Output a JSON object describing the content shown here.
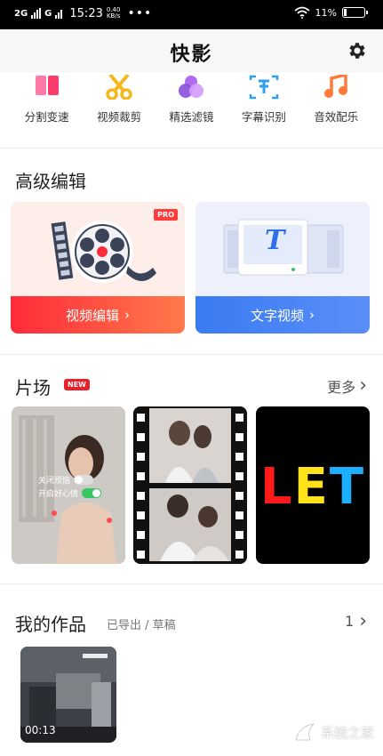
{
  "statusbar": {
    "network": "2G",
    "carrier_mark": "G",
    "time": "15:23",
    "speed_value": "0.40",
    "speed_unit": "KB/s",
    "more": "•••",
    "battery": "11%"
  },
  "header": {
    "title": "快影"
  },
  "tools": [
    {
      "label": "分割变速",
      "icon": "split-speed-icon"
    },
    {
      "label": "视频裁剪",
      "icon": "scissors-icon"
    },
    {
      "label": "精选滤镜",
      "icon": "filter-icon"
    },
    {
      "label": "字幕识别",
      "icon": "subtitle-icon"
    },
    {
      "label": "音效配乐",
      "icon": "music-icon"
    }
  ],
  "advanced": {
    "title": "高级编辑",
    "video_card": {
      "badge": "PRO",
      "label": "视频编辑"
    },
    "text_card": {
      "label": "文字视频",
      "art_letter": "T"
    }
  },
  "cinema": {
    "title": "片场",
    "badge": "NEW",
    "more_label": "更多",
    "thumb1": {
      "toggle_off_label": "关闭烦恼",
      "toggle_on_label": "开启好心情"
    },
    "thumb3": {
      "letters": [
        "L",
        "E",
        "T"
      ]
    }
  },
  "works": {
    "title": "我的作品",
    "subtitle": "已导出 / 草稿",
    "count": "1",
    "items": [
      {
        "duration": "00:13"
      }
    ]
  },
  "watermark": {
    "text": "系统之家"
  },
  "colors": {
    "accent_red": "#ff2a3a",
    "accent_blue": "#3a7bf2",
    "toggle_green": "#39c563",
    "let_colors": [
      "#ff1a1a",
      "#ffe21a",
      "#1ab0ff"
    ]
  }
}
